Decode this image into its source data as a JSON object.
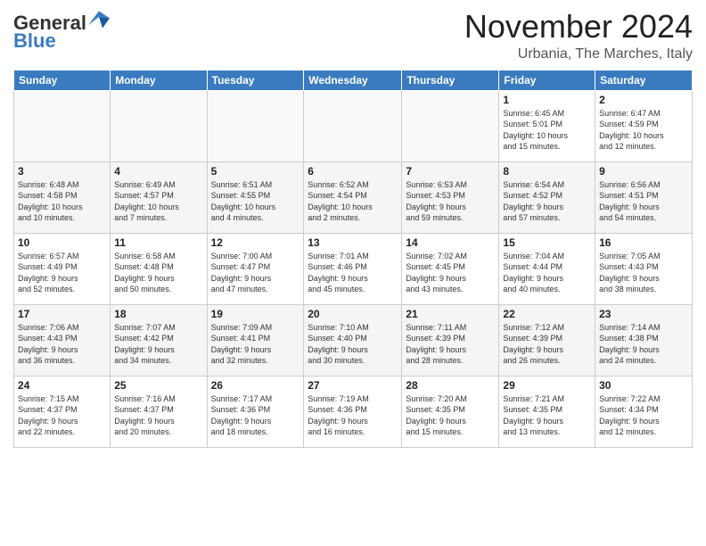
{
  "logo": {
    "general": "General",
    "blue": "Blue"
  },
  "title": "November 2024",
  "location": "Urbania, The Marches, Italy",
  "days_header": [
    "Sunday",
    "Monday",
    "Tuesday",
    "Wednesday",
    "Thursday",
    "Friday",
    "Saturday"
  ],
  "weeks": [
    [
      {
        "day": "",
        "info": ""
      },
      {
        "day": "",
        "info": ""
      },
      {
        "day": "",
        "info": ""
      },
      {
        "day": "",
        "info": ""
      },
      {
        "day": "",
        "info": ""
      },
      {
        "day": "1",
        "info": "Sunrise: 6:45 AM\nSunset: 5:01 PM\nDaylight: 10 hours\nand 15 minutes."
      },
      {
        "day": "2",
        "info": "Sunrise: 6:47 AM\nSunset: 4:59 PM\nDaylight: 10 hours\nand 12 minutes."
      }
    ],
    [
      {
        "day": "3",
        "info": "Sunrise: 6:48 AM\nSunset: 4:58 PM\nDaylight: 10 hours\nand 10 minutes."
      },
      {
        "day": "4",
        "info": "Sunrise: 6:49 AM\nSunset: 4:57 PM\nDaylight: 10 hours\nand 7 minutes."
      },
      {
        "day": "5",
        "info": "Sunrise: 6:51 AM\nSunset: 4:55 PM\nDaylight: 10 hours\nand 4 minutes."
      },
      {
        "day": "6",
        "info": "Sunrise: 6:52 AM\nSunset: 4:54 PM\nDaylight: 10 hours\nand 2 minutes."
      },
      {
        "day": "7",
        "info": "Sunrise: 6:53 AM\nSunset: 4:53 PM\nDaylight: 9 hours\nand 59 minutes."
      },
      {
        "day": "8",
        "info": "Sunrise: 6:54 AM\nSunset: 4:52 PM\nDaylight: 9 hours\nand 57 minutes."
      },
      {
        "day": "9",
        "info": "Sunrise: 6:56 AM\nSunset: 4:51 PM\nDaylight: 9 hours\nand 54 minutes."
      }
    ],
    [
      {
        "day": "10",
        "info": "Sunrise: 6:57 AM\nSunset: 4:49 PM\nDaylight: 9 hours\nand 52 minutes."
      },
      {
        "day": "11",
        "info": "Sunrise: 6:58 AM\nSunset: 4:48 PM\nDaylight: 9 hours\nand 50 minutes."
      },
      {
        "day": "12",
        "info": "Sunrise: 7:00 AM\nSunset: 4:47 PM\nDaylight: 9 hours\nand 47 minutes."
      },
      {
        "day": "13",
        "info": "Sunrise: 7:01 AM\nSunset: 4:46 PM\nDaylight: 9 hours\nand 45 minutes."
      },
      {
        "day": "14",
        "info": "Sunrise: 7:02 AM\nSunset: 4:45 PM\nDaylight: 9 hours\nand 43 minutes."
      },
      {
        "day": "15",
        "info": "Sunrise: 7:04 AM\nSunset: 4:44 PM\nDaylight: 9 hours\nand 40 minutes."
      },
      {
        "day": "16",
        "info": "Sunrise: 7:05 AM\nSunset: 4:43 PM\nDaylight: 9 hours\nand 38 minutes."
      }
    ],
    [
      {
        "day": "17",
        "info": "Sunrise: 7:06 AM\nSunset: 4:43 PM\nDaylight: 9 hours\nand 36 minutes."
      },
      {
        "day": "18",
        "info": "Sunrise: 7:07 AM\nSunset: 4:42 PM\nDaylight: 9 hours\nand 34 minutes."
      },
      {
        "day": "19",
        "info": "Sunrise: 7:09 AM\nSunset: 4:41 PM\nDaylight: 9 hours\nand 32 minutes."
      },
      {
        "day": "20",
        "info": "Sunrise: 7:10 AM\nSunset: 4:40 PM\nDaylight: 9 hours\nand 30 minutes."
      },
      {
        "day": "21",
        "info": "Sunrise: 7:11 AM\nSunset: 4:39 PM\nDaylight: 9 hours\nand 28 minutes."
      },
      {
        "day": "22",
        "info": "Sunrise: 7:12 AM\nSunset: 4:39 PM\nDaylight: 9 hours\nand 26 minutes."
      },
      {
        "day": "23",
        "info": "Sunrise: 7:14 AM\nSunset: 4:38 PM\nDaylight: 9 hours\nand 24 minutes."
      }
    ],
    [
      {
        "day": "24",
        "info": "Sunrise: 7:15 AM\nSunset: 4:37 PM\nDaylight: 9 hours\nand 22 minutes."
      },
      {
        "day": "25",
        "info": "Sunrise: 7:16 AM\nSunset: 4:37 PM\nDaylight: 9 hours\nand 20 minutes."
      },
      {
        "day": "26",
        "info": "Sunrise: 7:17 AM\nSunset: 4:36 PM\nDaylight: 9 hours\nand 18 minutes."
      },
      {
        "day": "27",
        "info": "Sunrise: 7:19 AM\nSunset: 4:36 PM\nDaylight: 9 hours\nand 16 minutes."
      },
      {
        "day": "28",
        "info": "Sunrise: 7:20 AM\nSunset: 4:35 PM\nDaylight: 9 hours\nand 15 minutes."
      },
      {
        "day": "29",
        "info": "Sunrise: 7:21 AM\nSunset: 4:35 PM\nDaylight: 9 hours\nand 13 minutes."
      },
      {
        "day": "30",
        "info": "Sunrise: 7:22 AM\nSunset: 4:34 PM\nDaylight: 9 hours\nand 12 minutes."
      }
    ]
  ]
}
